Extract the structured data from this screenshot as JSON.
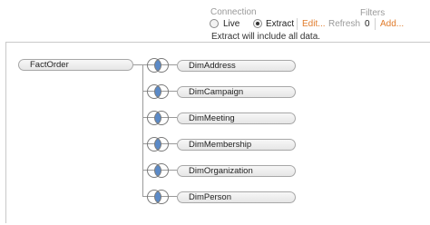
{
  "connection": {
    "title": "Connection",
    "live_label": "Live",
    "extract_label": "Extract",
    "selected": "Extract",
    "edit_label": "Edit...",
    "refresh_label": "Refresh",
    "extract_note": "Extract will include all data."
  },
  "filters": {
    "title": "Filters",
    "count": "0",
    "add_label": "Add..."
  },
  "join": {
    "fact_table": "FactOrder",
    "tables": [
      {
        "name": "DimAddress"
      },
      {
        "name": "DimCampaign"
      },
      {
        "name": "DimMeeting"
      },
      {
        "name": "DimMembership"
      },
      {
        "name": "DimOrganization"
      },
      {
        "name": "DimPerson"
      }
    ],
    "join_type_icon": "inner-join-venn-icon"
  },
  "colors": {
    "accent": "#e07b2b",
    "join_fill": "#5b8ac7",
    "muted": "#9a9a9a"
  }
}
